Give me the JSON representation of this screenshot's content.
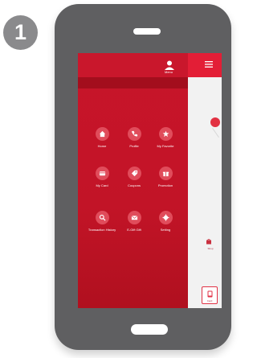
{
  "step": {
    "number": "1"
  },
  "colors": {
    "phone_body": "#5f5f61",
    "menu_red": "#c8152a",
    "icon_circle": "#e04c5b",
    "badge_gray": "#8a8a8c"
  },
  "menu": {
    "profile_label": "Menu",
    "items": [
      {
        "label": "Home",
        "icon": "home-icon"
      },
      {
        "label": "Profile",
        "icon": "phone-icon"
      },
      {
        "label": "My Favorite",
        "icon": "star-icon"
      },
      {
        "label": "My Card",
        "icon": "card-icon"
      },
      {
        "label": "Coupons",
        "icon": "tag-icon"
      },
      {
        "label": "Promotion",
        "icon": "gift-icon"
      },
      {
        "label": "Transaction History",
        "icon": "search-icon"
      },
      {
        "label": "E-Gift Gift",
        "icon": "envelope-icon"
      },
      {
        "label": "Setting",
        "icon": "gear-icon"
      }
    ]
  },
  "strip": {
    "bag_label": "Shop",
    "bottom_label": "Card"
  }
}
